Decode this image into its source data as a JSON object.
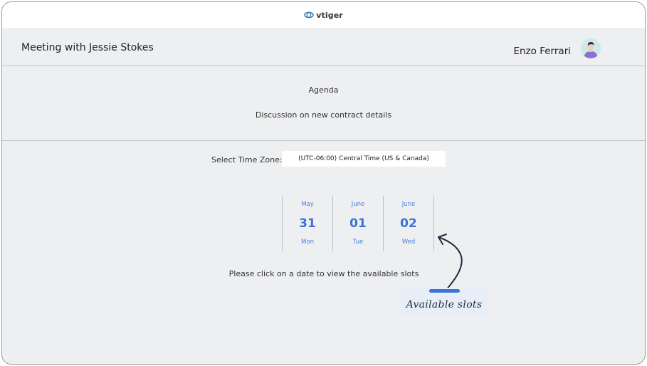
{
  "app": {
    "brand": "vtiger"
  },
  "meeting": {
    "title": "Meeting with Jessie Stokes",
    "host": "Enzo Ferrari"
  },
  "agenda": {
    "label": "Agenda",
    "text": "Discussion on new contract details"
  },
  "timezone": {
    "label": "Select Time Zone:",
    "value": "(UTC-06:00) Central Time (US & Canada)"
  },
  "dates": [
    {
      "month": "May",
      "day": "31",
      "weekday": "Mon"
    },
    {
      "month": "June",
      "day": "01",
      "weekday": "Tue"
    },
    {
      "month": "June",
      "day": "02",
      "weekday": "Wed"
    }
  ],
  "hint": "Please click on a date to view the available slots",
  "annotation": {
    "label": "Available slots"
  },
  "colors": {
    "accent": "#3b74d6",
    "brand": "#2f7fb0",
    "panel": "#eeeff1"
  }
}
